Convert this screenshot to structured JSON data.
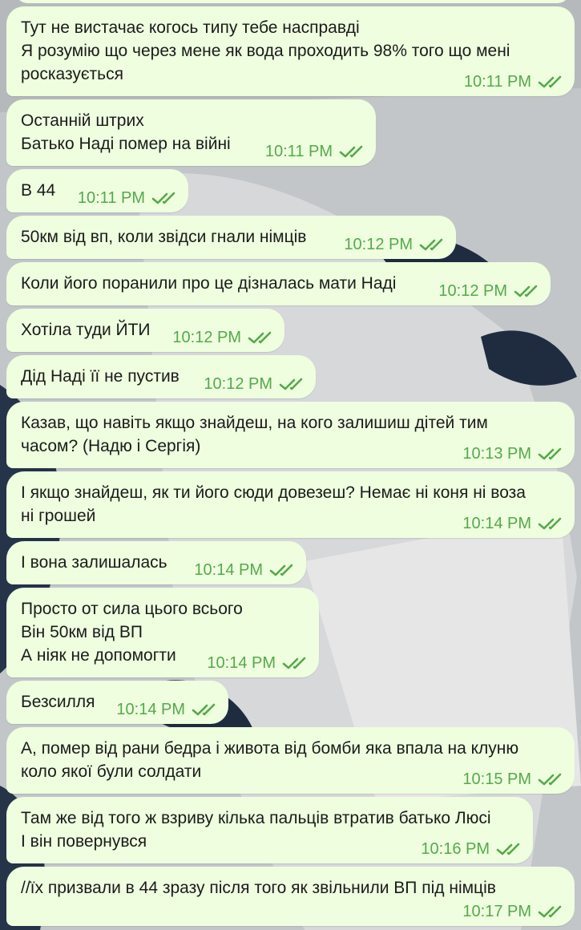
{
  "chat": {
    "colors": {
      "bubble": "#eefedf",
      "text": "#1b1b1b",
      "time": "#55a94a",
      "check": "#55a94a"
    },
    "status_icon": "double-check-icon",
    "messages": [
      {
        "lines": [
          "Тут не вистачає когось типу тебе насправді",
          "Я розумію що через мене як вода проходить 98% того що мені",
          "росказується"
        ],
        "time": "10:11 PM"
      },
      {
        "lines": [
          "Останній штрих",
          "Батько Наді помер на війні"
        ],
        "time": "10:11 PM"
      },
      {
        "lines": [
          "В 44"
        ],
        "time": "10:11 PM"
      },
      {
        "lines": [
          "50км від вп, коли звідси гнали німців"
        ],
        "time": "10:12 PM"
      },
      {
        "lines": [
          "Коли його поранили про це дізналась мати Наді"
        ],
        "time": "10:12 PM"
      },
      {
        "lines": [
          "Хотіла туди ЙТИ"
        ],
        "time": "10:12 PM"
      },
      {
        "lines": [
          "Дід Наді її не пустив"
        ],
        "time": "10:12 PM"
      },
      {
        "lines": [
          "Казав, що навіть якщо знайдеш, на кого залишиш дітей тим",
          "часом? (Надю і Сергія)"
        ],
        "time": "10:13 PM"
      },
      {
        "lines": [
          "І якщо знайдеш, як ти його сюди довезеш? Немає ні коня ні воза",
          "ні грошей"
        ],
        "time": "10:14 PM"
      },
      {
        "lines": [
          "І вона залишалась"
        ],
        "time": "10:14 PM"
      },
      {
        "lines": [
          "Просто от сила цього всього",
          "Він 50км від ВП",
          "А ніяк не допомогти"
        ],
        "time": "10:14 PM"
      },
      {
        "lines": [
          "Безсилля"
        ],
        "time": "10:14 PM"
      },
      {
        "lines": [
          "А, помер від рани бедра і живота від бомби яка впала на клуню",
          "коло якої були солдати"
        ],
        "time": "10:15 PM"
      },
      {
        "lines": [
          "Там же від того ж взриву кілька пальців втратив батько Люсі",
          "І він повернувся"
        ],
        "time": "10:16 PM"
      },
      {
        "lines": [
          "//їх призвали в 44 зразу після того як звільнили ВП під німців"
        ],
        "time": "10:17 PM"
      }
    ]
  }
}
